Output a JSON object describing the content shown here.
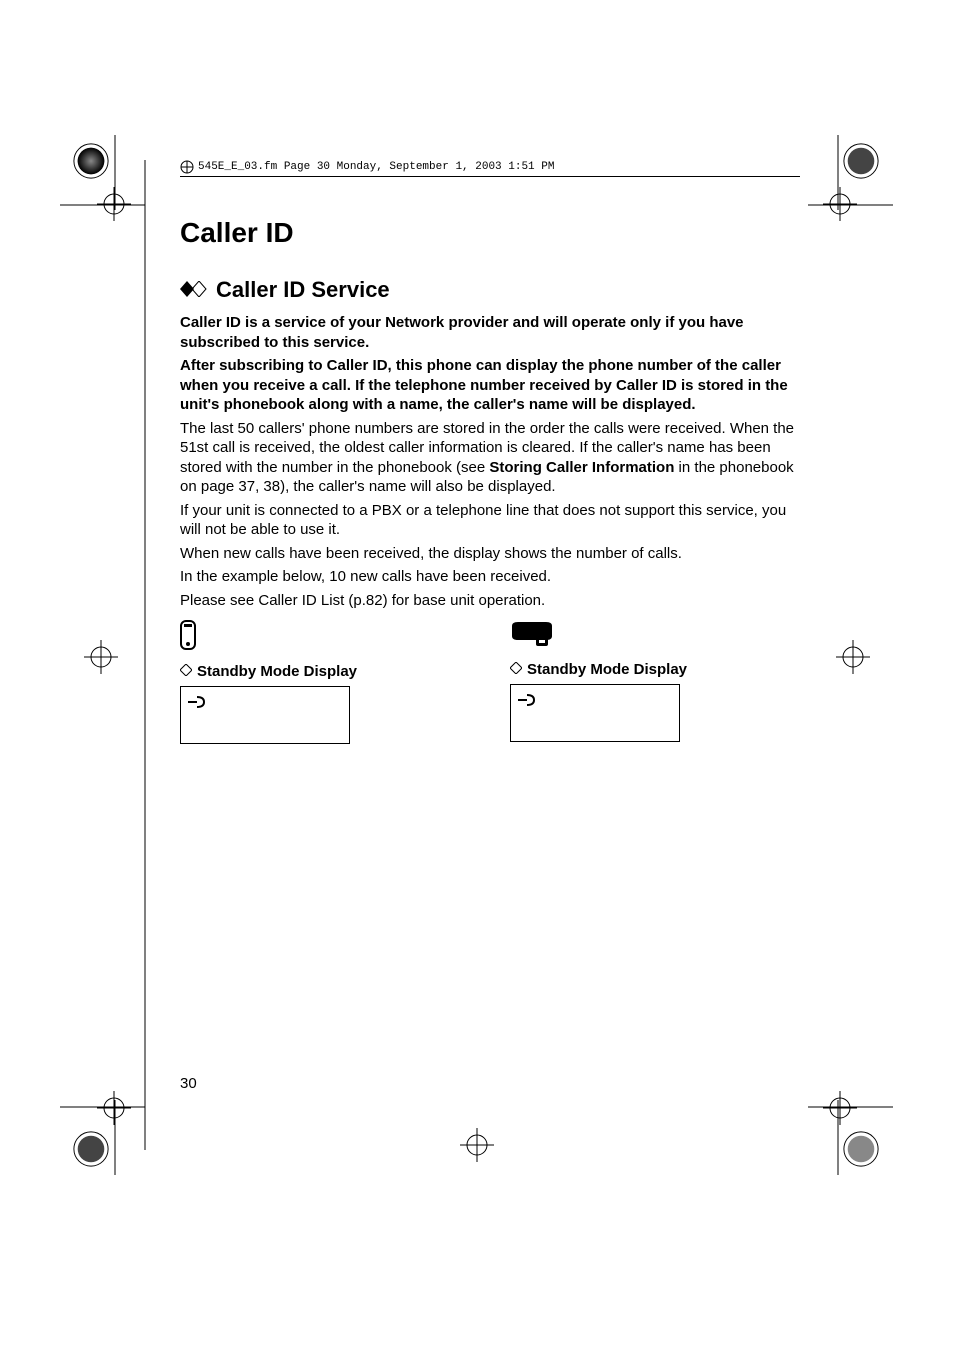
{
  "header": {
    "text": "545E_E_03.fm  Page 30  Monday, September 1, 2003  1:51 PM"
  },
  "title": "Caller ID",
  "section_title": "Caller ID Service",
  "paragraphs": {
    "bold1": "Caller ID is a service of your Network provider and will operate only if you have subscribed to this service.",
    "bold2": "After subscribing to Caller ID, this phone can display the phone number of the caller when you receive a call. If the telephone number received by Caller ID is stored in the unit's phonebook along with a name, the caller's name will be displayed.",
    "p1_pre": "The last 50 callers' phone numbers are stored in the order the calls were received. When the 51st call is received, the oldest caller information is cleared. If the caller's name has been stored with the number in the phonebook (see ",
    "p1_strong": "Storing Caller Information",
    "p1_post": " in the phonebook on page 37, 38), the caller's name will also be displayed.",
    "p2": "If your unit is connected to a PBX or a telephone line that does not support this service, you will not be able to use it.",
    "p3": "When new calls have been received, the display shows the number of calls.",
    "p4": "In the example below, 10 new calls have been received.",
    "p5": "Please see Caller ID List (p.82) for base unit operation."
  },
  "columns": {
    "left": {
      "heading": "Standby Mode Display"
    },
    "right": {
      "heading": "Standby Mode Display"
    }
  },
  "page_number": "30"
}
